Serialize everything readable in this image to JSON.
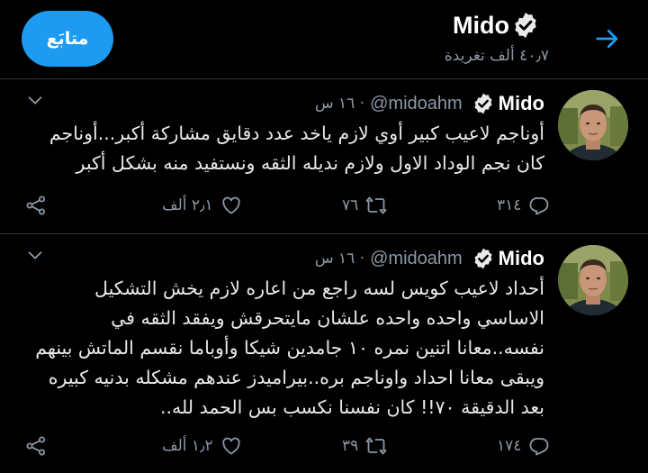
{
  "header": {
    "follow_label": "متابَع",
    "profile_name": "Mido",
    "tweet_count": "٤٠٫٧ ألف تغريدة"
  },
  "tweets": [
    {
      "name": "Mido",
      "handle": "@midoahm",
      "time": "· ١٦ س",
      "text": "أوناجم لاعيب كبير أوي لازم ياخد عدد دقايق مشاركة أكبر...أوناجم كان نجم الوداد الاول ولازم نديله الثقه ونستفيد منه بشكل أكبر",
      "replies": "٣١٤",
      "retweets": "٧٦",
      "likes": "٢٫١ ألف"
    },
    {
      "name": "Mido",
      "handle": "@midoahm",
      "time": "· ١٦ س",
      "text": "أحداد لاعيب كويس لسه راجع من اعاره لازم يخش التشكيل الاساسي واحده واحده علشان مايتحرقش ويفقد الثقه في نفسه..معانا اتنين نمره ١٠ جامدين شيكا وأوباما نقسم الماتش بينهم ويبقى معانا احداد واوناجم بره..بيراميدز عندهم مشكله بدنيه كبيره بعد الدقيقة ٧٠!! كان نفسنا نكسب بس الحمد لله..",
      "replies": "١٧٤",
      "retweets": "٣٩",
      "likes": "١٫٢ ألف"
    }
  ],
  "colors": {
    "background": "#000000",
    "accent": "#1d9bf0",
    "muted": "#8b98a5",
    "divider": "#2f3336"
  },
  "icons": [
    "arrow-right-icon",
    "verified-badge-icon",
    "chevron-down-icon",
    "reply-icon",
    "retweet-icon",
    "like-icon",
    "share-icon"
  ]
}
